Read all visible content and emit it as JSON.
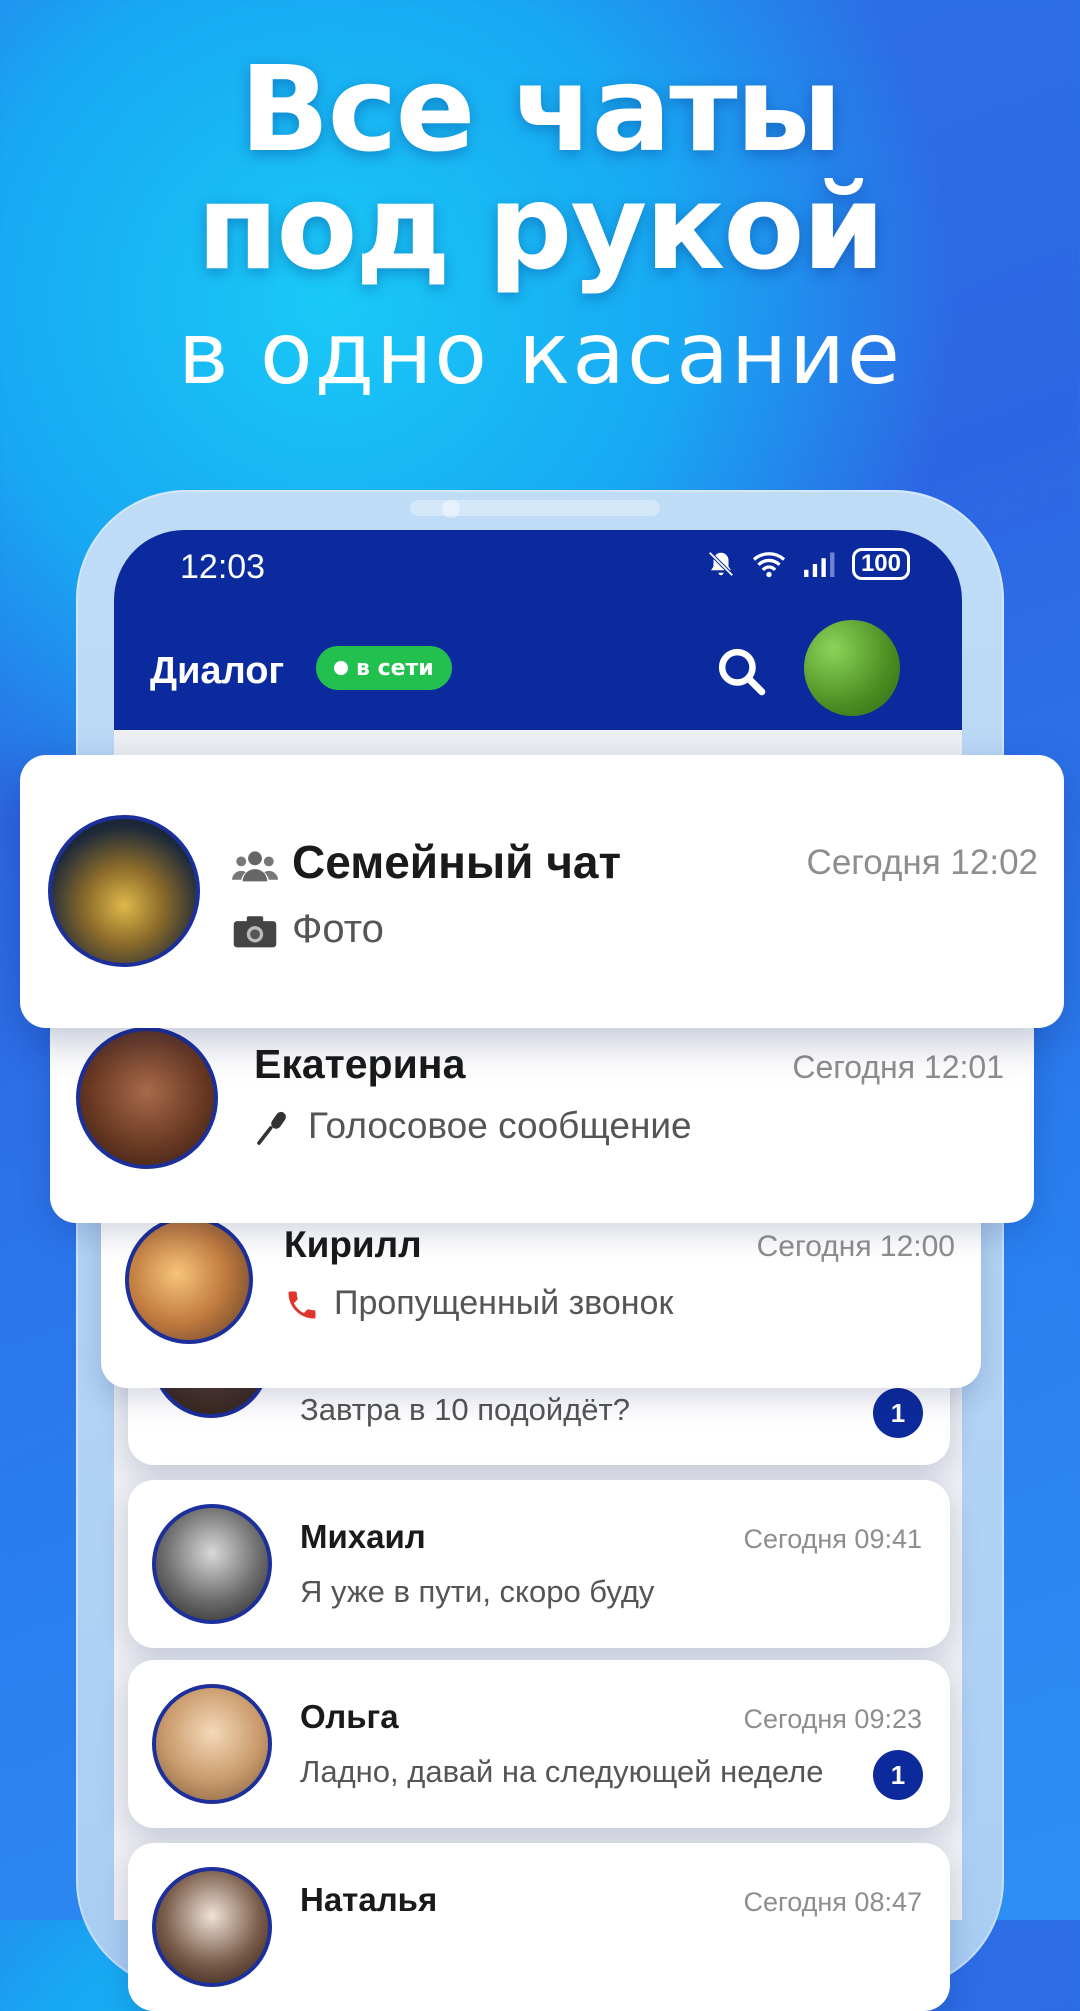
{
  "hero": {
    "line1": "Все чаты",
    "line2": "под рукой",
    "subtitle": "в одно касание"
  },
  "status_bar": {
    "time": "12:03",
    "battery": "100"
  },
  "app_bar": {
    "title": "Диалог",
    "online_label": "в сети"
  },
  "chats": [
    {
      "name": "Семейный чат",
      "time": "Сегодня 12:02",
      "message": "Фото",
      "icon": "camera-icon",
      "group": true
    },
    {
      "name": "Екатерина",
      "time": "Сегодня 12:01",
      "message": "Голосовое сообщение",
      "icon": "microphone-icon"
    },
    {
      "name": "Кирилл",
      "time": "Сегодня 12:00",
      "message": "Пропущенный звонок",
      "icon": "phone-icon"
    },
    {
      "name": "",
      "time": "",
      "message": "Завтра в 10 подойдёт?",
      "unread": "1"
    },
    {
      "name": "Михаил",
      "time": "Сегодня 09:41",
      "message": "Я уже в пути, скоро буду"
    },
    {
      "name": "Ольга",
      "time": "Сегодня 09:23",
      "message": "Ладно, давай на следующей неделе",
      "unread": "1"
    },
    {
      "name": "Наталья",
      "time": "Сегодня 08:47",
      "message": ""
    }
  ],
  "colors": {
    "app_bar": "#0a2a9e",
    "online": "#22c04e",
    "badge": "#0c2a9c"
  }
}
